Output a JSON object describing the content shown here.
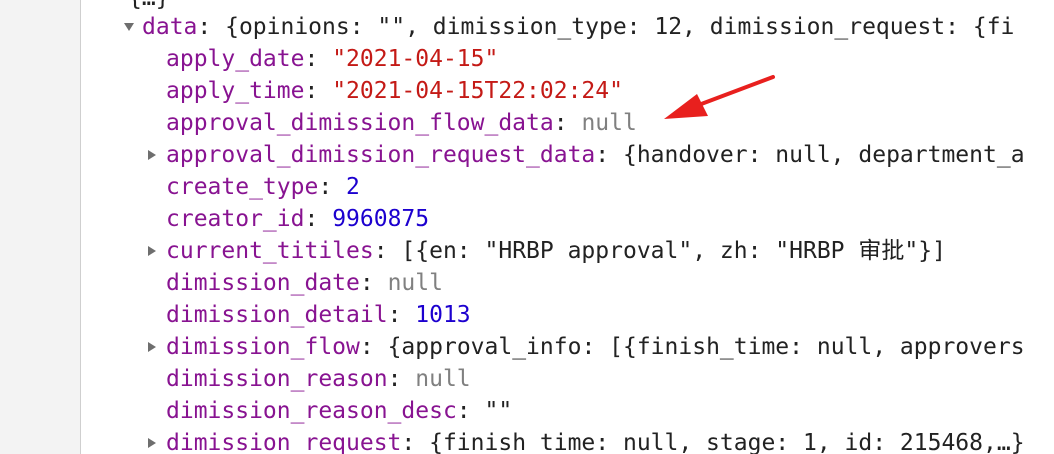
{
  "top_fragment": "{…}",
  "rows": {
    "data": {
      "key": "data",
      "preview": "{opinions: \"\", dimission_type: 12, dimission_request: {fi"
    },
    "apply_date": {
      "key": "apply_date",
      "value": "\"2021-04-15\""
    },
    "apply_time": {
      "key": "apply_time",
      "value": "\"2021-04-15T22:02:24\""
    },
    "approval_dimission_flow_data": {
      "key": "approval_dimission_flow_data",
      "value": "null"
    },
    "approval_dimission_request_data": {
      "key": "approval_dimission_request_data",
      "preview": "{handover: null, department_a"
    },
    "create_type": {
      "key": "create_type",
      "value": "2"
    },
    "creator_id": {
      "key": "creator_id",
      "value": "9960875"
    },
    "current_titiles": {
      "key": "current_titiles",
      "preview": "[{en: \"HRBP approval\", zh: \"HRBP 审批\"}]"
    },
    "dimission_date": {
      "key": "dimission_date",
      "value": "null"
    },
    "dimission_detail": {
      "key": "dimission_detail",
      "value": "1013"
    },
    "dimission_flow": {
      "key": "dimission_flow",
      "preview": "{approval_info: [{finish_time: null, approvers"
    },
    "dimission_reason": {
      "key": "dimission_reason",
      "value": "null"
    },
    "dimission_reason_desc": {
      "key": "dimission_reason_desc",
      "value": "\"\""
    },
    "dimission_request": {
      "key": "dimission_request",
      "preview": "{finish_time: null, stage: 1, id: 215468,…}"
    }
  },
  "colors": {
    "key": "#881391",
    "string": "#c41a16",
    "number": "#1c00cf",
    "null": "#808080",
    "annotation_arrow": "#e8201e"
  },
  "icons": {
    "expanded": "triangle-down-icon",
    "collapsed": "triangle-right-icon",
    "annotation": "red-arrow-icon"
  }
}
